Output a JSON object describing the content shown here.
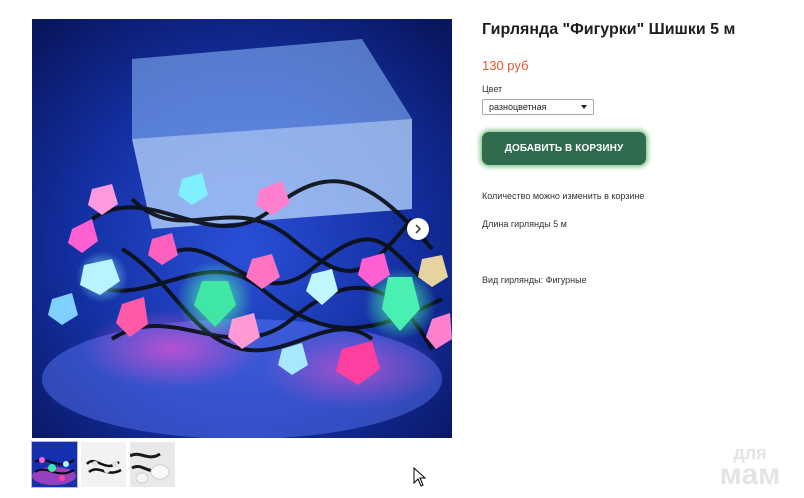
{
  "product": {
    "title": "Гирлянда \"Фигурки\" Шишки 5 м",
    "price": "130 руб",
    "color": {
      "label": "Цвет",
      "selected": "разноцветная"
    },
    "add_to_cart_label": "ДОБАВИТЬ В КОРЗИНУ",
    "notes": [
      "Количество можно изменить в корзине",
      "Длина гирлянды 5 м",
      "Вид гирлянды: Фигурные"
    ]
  },
  "gallery": {
    "thumbnail_count": 3,
    "active_index": 0,
    "next_icon": "chevron-right-icon"
  },
  "watermark": {
    "line1": "для",
    "line2": "мам"
  },
  "colors": {
    "accent_green": "#2f6b4c",
    "price_orange": "#e4572e",
    "glow_green": "#6ebe78"
  }
}
